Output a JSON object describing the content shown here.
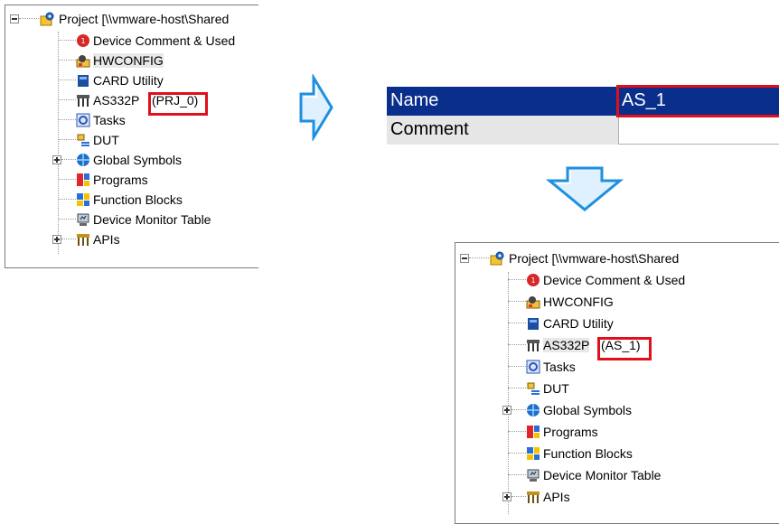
{
  "tree_before": {
    "root": "Project [\\\\vmware-host\\Shared",
    "items": [
      {
        "label": "Device Comment & Used",
        "icon": "device-comment-icon"
      },
      {
        "label": "HWCONFIG",
        "icon": "hwconfig-icon"
      },
      {
        "label": "CARD Utility",
        "icon": "card-utility-icon"
      },
      {
        "label": "AS332P",
        "icon": "plc-icon",
        "suffix": "(PRJ_0)"
      },
      {
        "label": "Tasks",
        "icon": "tasks-icon"
      },
      {
        "label": "DUT",
        "icon": "dut-icon"
      },
      {
        "label": "Global Symbols",
        "icon": "global-symbols-icon"
      },
      {
        "label": "Programs",
        "icon": "programs-icon"
      },
      {
        "label": "Function Blocks",
        "icon": "function-blocks-icon"
      },
      {
        "label": "Device Monitor Table",
        "icon": "device-monitor-icon"
      },
      {
        "label": "APIs",
        "icon": "apis-icon"
      }
    ]
  },
  "properties": {
    "name_label": "Name",
    "name_value": "AS_1",
    "comment_label": "Comment",
    "comment_value": ""
  },
  "tree_after": {
    "root": "Project [\\\\vmware-host\\Shared",
    "items": [
      {
        "label": "Device Comment & Used"
      },
      {
        "label": "HWCONFIG"
      },
      {
        "label": "CARD Utility"
      },
      {
        "label": "AS332P",
        "suffix": "(AS_1)"
      },
      {
        "label": "Tasks"
      },
      {
        "label": "DUT"
      },
      {
        "label": "Global Symbols"
      },
      {
        "label": "Programs"
      },
      {
        "label": "Function Blocks"
      },
      {
        "label": "Device Monitor Table"
      },
      {
        "label": "APIs"
      }
    ]
  },
  "colors": {
    "highlight": "#e0101a",
    "arrow_fill": "#ffffff",
    "arrow_stroke": "#1f8fe0",
    "grid_header": "#0a2e8c"
  },
  "arrows": [
    "right-arrow-icon",
    "down-arrow-icon"
  ]
}
